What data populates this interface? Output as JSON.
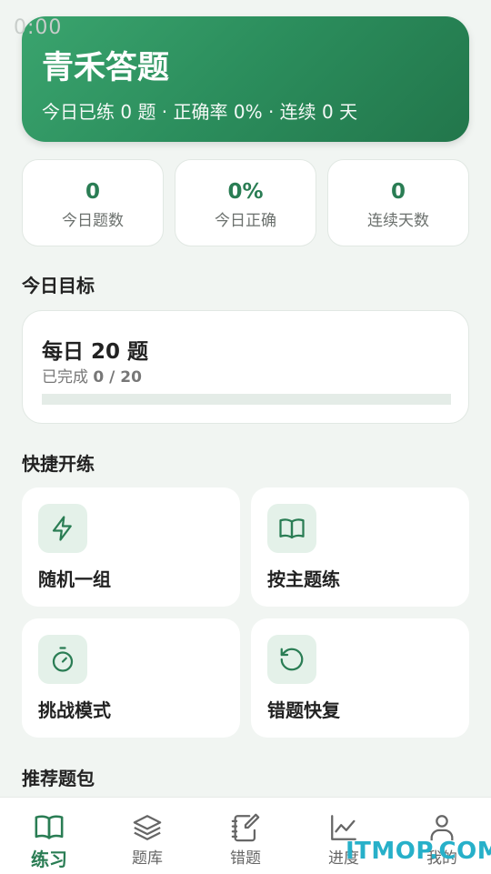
{
  "status_bar": {
    "time": "0:00"
  },
  "hero": {
    "title": "青禾答题",
    "subtitle": "今日已练 0 题 · 正确率 0% · 连续 0 天"
  },
  "stats": [
    {
      "value": "0",
      "label": "今日题数"
    },
    {
      "value": "0%",
      "label": "今日正确"
    },
    {
      "value": "0",
      "label": "连续天数"
    }
  ],
  "goal": {
    "section_title": "今日目标",
    "title": "每日 20 题",
    "progress_prefix": "已完成",
    "progress_text": "0 / 20",
    "progress_fraction": 0
  },
  "quick": {
    "section_title": "快捷开练",
    "items": [
      {
        "label": "随机一组",
        "icon": "lightning-icon"
      },
      {
        "label": "按主题练",
        "icon": "book-icon"
      },
      {
        "label": "挑战模式",
        "icon": "stopwatch-icon"
      },
      {
        "label": "错题快复",
        "icon": "retry-icon"
      }
    ]
  },
  "recommend": {
    "section_title": "推荐题包"
  },
  "tabs": [
    {
      "label": "练习",
      "icon": "book-icon",
      "active": true
    },
    {
      "label": "题库",
      "icon": "layers-icon",
      "active": false
    },
    {
      "label": "错题",
      "icon": "notebook-edit-icon",
      "active": false
    },
    {
      "label": "进度",
      "icon": "line-chart-icon",
      "active": false
    },
    {
      "label": "我的",
      "icon": "user-icon",
      "active": false
    }
  ],
  "colors": {
    "accent": "#2a7d54",
    "background": "#f1f5f2",
    "watermark": "#27b0c9"
  },
  "watermark": "ITMOP.COM"
}
